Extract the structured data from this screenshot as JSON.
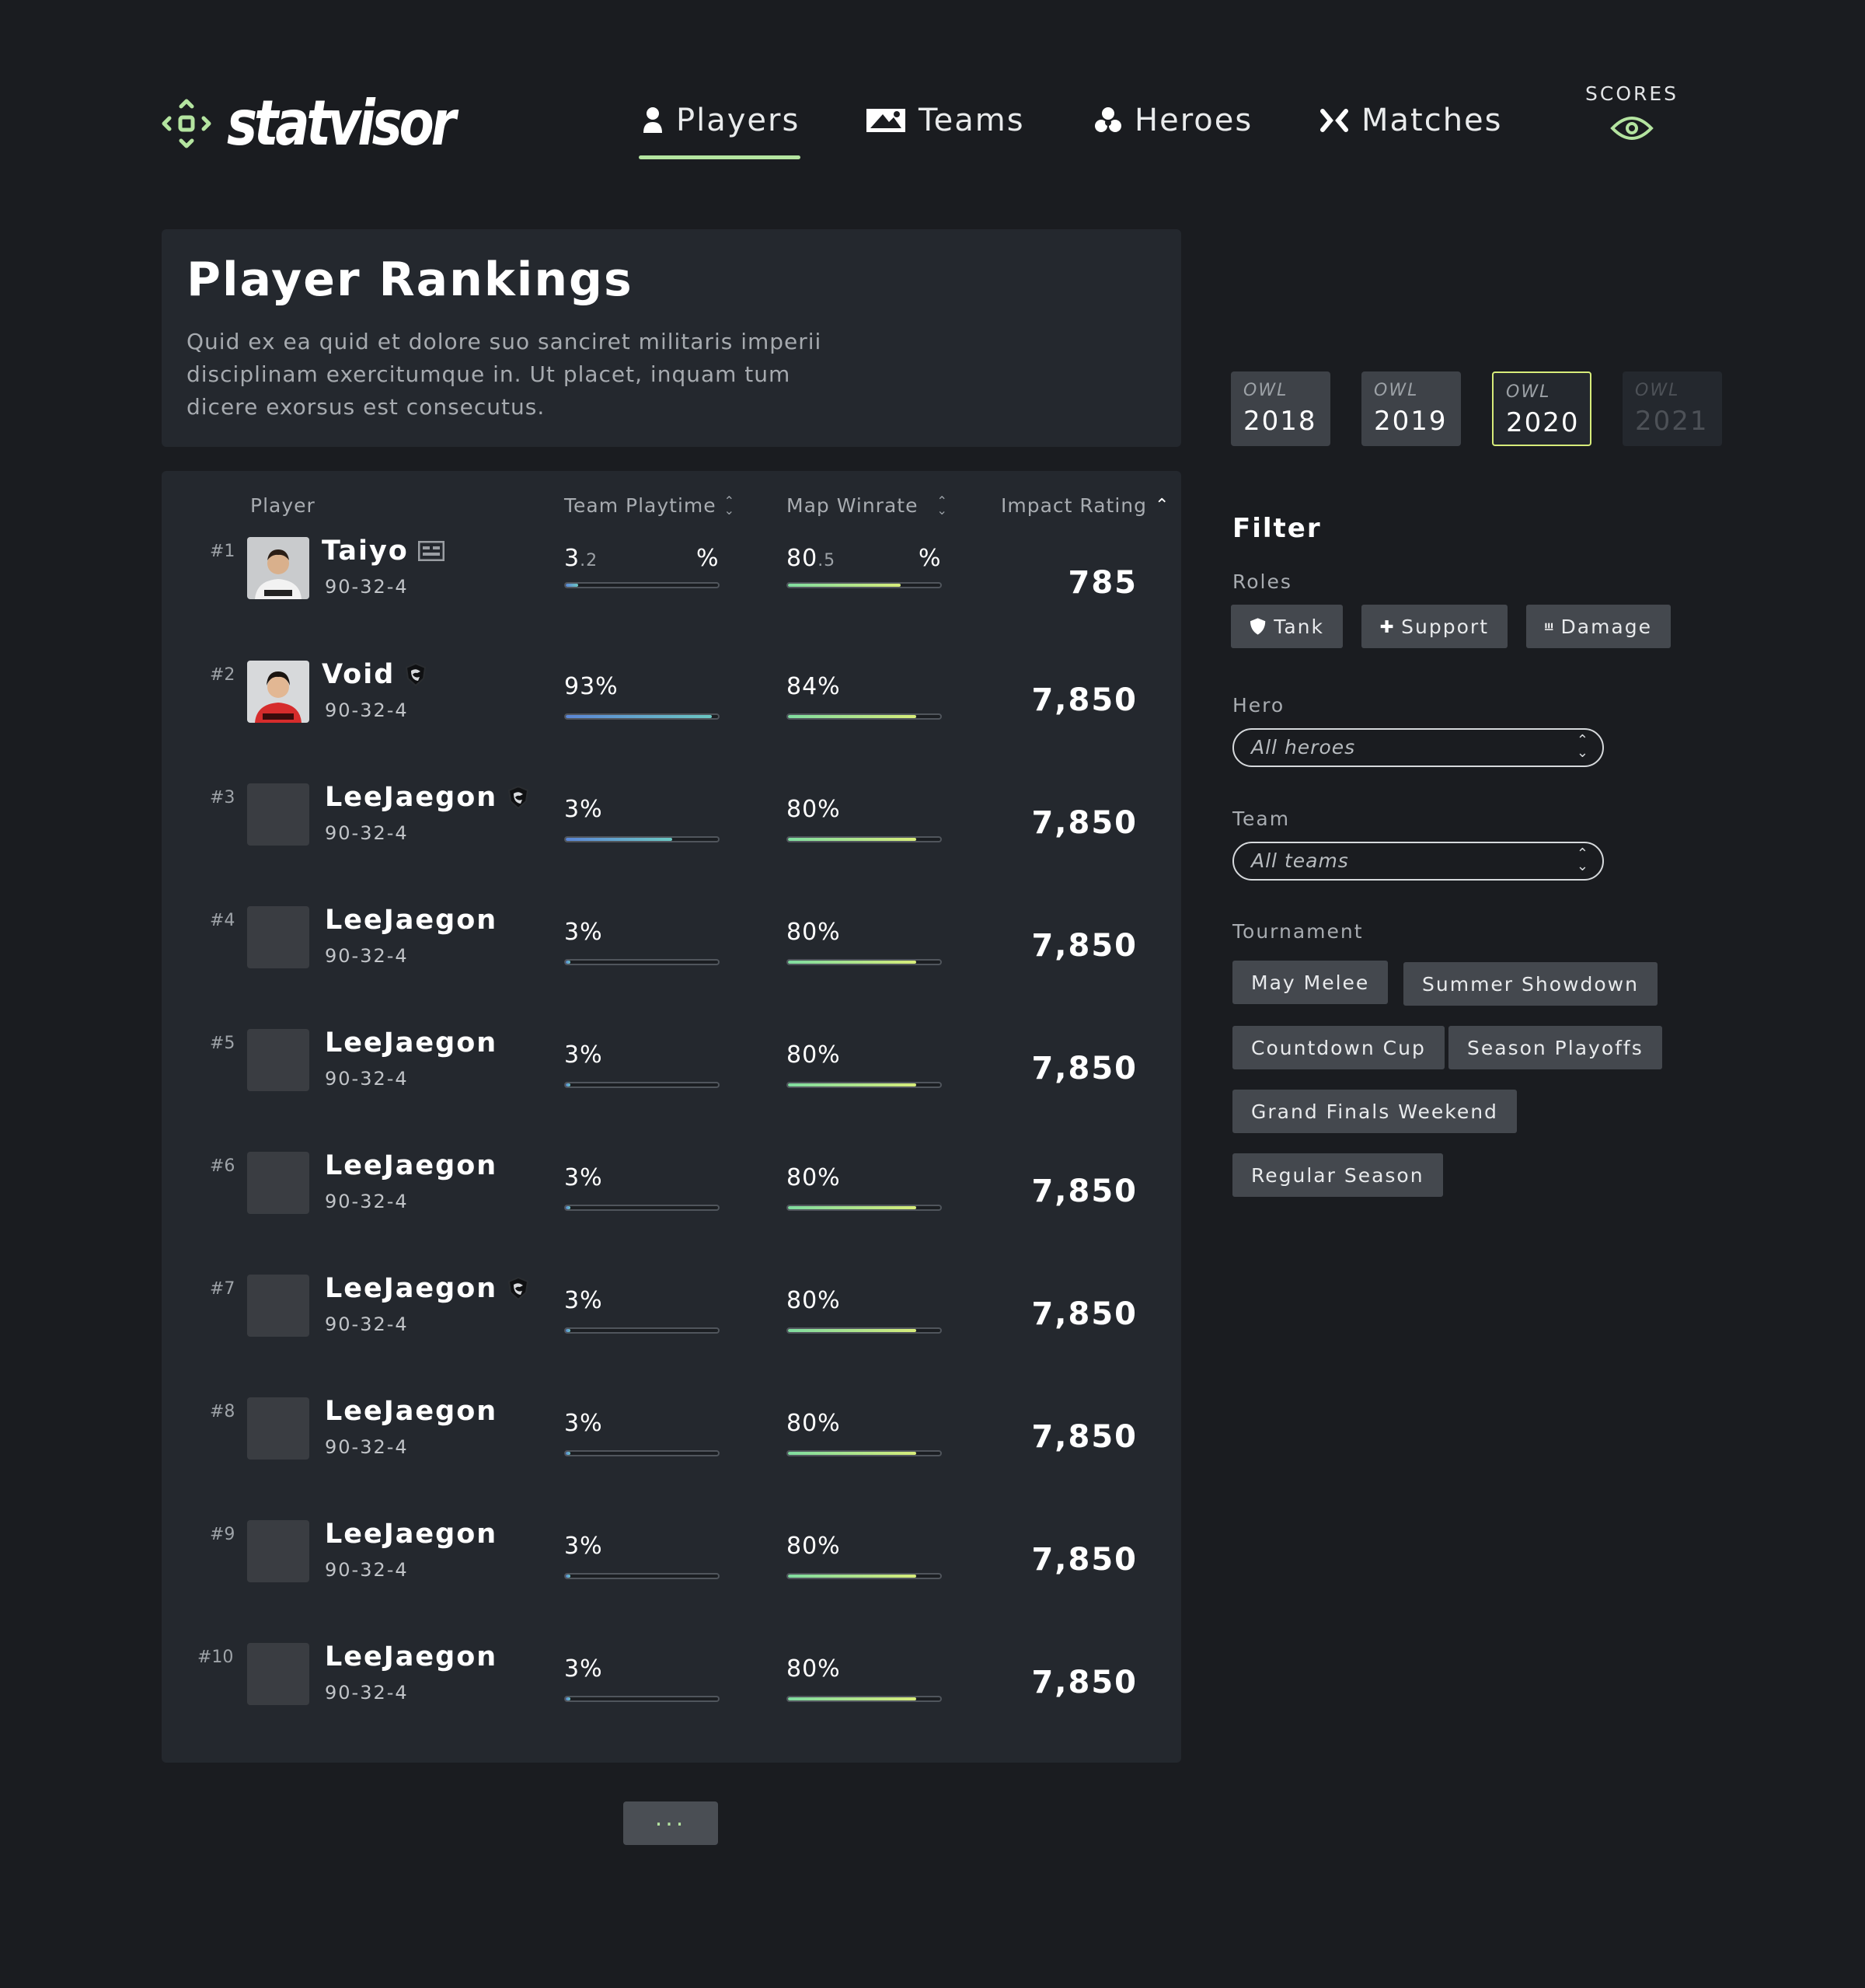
{
  "brand": {
    "name": "statvisor",
    "accent": "#b4e4a0"
  },
  "nav": {
    "items": [
      {
        "label": "Players",
        "icon": "user-icon",
        "active": true
      },
      {
        "label": "Teams",
        "icon": "team-flag-icon",
        "active": false
      },
      {
        "label": "Heroes",
        "icon": "heroes-icon",
        "active": false
      },
      {
        "label": "Matches",
        "icon": "versus-icon",
        "active": false
      }
    ],
    "scores_label": "SCORES"
  },
  "page": {
    "title": "Player Rankings",
    "description": "Quid ex ea quid et dolore suo sanciret militaris imperii disciplinam exercitumque in. Ut placet, inquam tum dicere exorsus est consecutus."
  },
  "table": {
    "headers": {
      "player": "Player",
      "playtime": "Team Playtime",
      "winrate": "Map Winrate",
      "impact": "Impact Rating"
    },
    "rows": [
      {
        "rank": "#1",
        "name": "Taiyo",
        "record": "90-32-4",
        "playtime_int": "3",
        "playtime_dec": ".2",
        "playtime_pct": "%",
        "playtime_fill": 0.08,
        "winrate_int": "80",
        "winrate_dec": ".5",
        "winrate_pct": "%",
        "winrate_fill": 0.74,
        "rating": "785",
        "team": "shock"
      },
      {
        "rank": "#2",
        "name": "Void",
        "record": "90-32-4",
        "playtime_text": "93%",
        "playtime_fill": 0.96,
        "winrate_text": "84%",
        "winrate_fill": 0.84,
        "rating": "7,850",
        "team": "dragons"
      },
      {
        "rank": "#3",
        "name": "LeeJaegon",
        "record": "90-32-4",
        "playtime_text": "3%",
        "playtime_fill": 0.7,
        "winrate_text": "80%",
        "winrate_fill": 0.84,
        "rating": "7,850",
        "team": "dragons"
      },
      {
        "rank": "#4",
        "name": "LeeJaegon",
        "record": "90-32-4",
        "playtime_text": "3%",
        "playtime_fill": 0.03,
        "winrate_text": "80%",
        "winrate_fill": 0.84,
        "rating": "7,850"
      },
      {
        "rank": "#5",
        "name": "LeeJaegon",
        "record": "90-32-4",
        "playtime_text": "3%",
        "playtime_fill": 0.03,
        "winrate_text": "80%",
        "winrate_fill": 0.84,
        "rating": "7,850"
      },
      {
        "rank": "#6",
        "name": "LeeJaegon",
        "record": "90-32-4",
        "playtime_text": "3%",
        "playtime_fill": 0.03,
        "winrate_text": "80%",
        "winrate_fill": 0.84,
        "rating": "7,850"
      },
      {
        "rank": "#7",
        "name": "LeeJaegon",
        "record": "90-32-4",
        "playtime_text": "3%",
        "playtime_fill": 0.03,
        "winrate_text": "80%",
        "winrate_fill": 0.84,
        "rating": "7,850",
        "team": "dragons"
      },
      {
        "rank": "#8",
        "name": "LeeJaegon",
        "record": "90-32-4",
        "playtime_text": "3%",
        "playtime_fill": 0.03,
        "winrate_text": "80%",
        "winrate_fill": 0.84,
        "rating": "7,850"
      },
      {
        "rank": "#9",
        "name": "LeeJaegon",
        "record": "90-32-4",
        "playtime_text": "3%",
        "playtime_fill": 0.03,
        "winrate_text": "80%",
        "winrate_fill": 0.84,
        "rating": "7,850"
      },
      {
        "rank": "#10",
        "name": "LeeJaegon",
        "record": "90-32-4",
        "playtime_text": "3%",
        "playtime_fill": 0.03,
        "winrate_text": "80%",
        "winrate_fill": 0.84,
        "rating": "7,850"
      }
    ],
    "more_label": "..."
  },
  "seasons": [
    {
      "league": "OWL",
      "year": "2018",
      "state": "normal"
    },
    {
      "league": "OWL",
      "year": "2019",
      "state": "normal"
    },
    {
      "league": "OWL",
      "year": "2020",
      "state": "active"
    },
    {
      "league": "OWL",
      "year": "2021",
      "state": "disabled"
    }
  ],
  "filter": {
    "title": "Filter",
    "roles_label": "Roles",
    "roles": [
      "Tank",
      "Support",
      "Damage"
    ],
    "hero_label": "Hero",
    "hero_value": "All heroes",
    "team_label": "Team",
    "team_value": "All teams",
    "tournament_label": "Tournament",
    "tournaments": [
      "May Melee",
      "Summer Showdown",
      "Countdown Cup",
      "Season Playoffs",
      "Grand Finals Weekend",
      "Regular Season"
    ]
  }
}
